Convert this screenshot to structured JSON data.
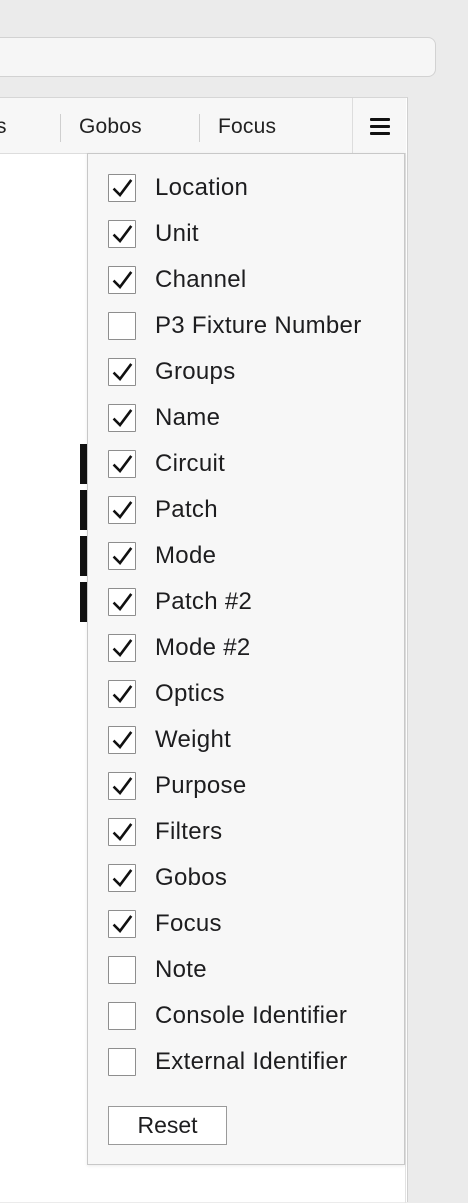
{
  "table": {
    "headers": [
      {
        "label": "s"
      },
      {
        "label": "Gobos"
      },
      {
        "label": "Focus"
      }
    ],
    "menu_icon": "hamburger-menu-icon"
  },
  "columns_menu": {
    "options": [
      {
        "label": "Location",
        "checked": true
      },
      {
        "label": "Unit",
        "checked": true
      },
      {
        "label": "Channel",
        "checked": true
      },
      {
        "label": "P3 Fixture Number",
        "checked": false
      },
      {
        "label": "Groups",
        "checked": true
      },
      {
        "label": "Name",
        "checked": true
      },
      {
        "label": "Circuit",
        "checked": true
      },
      {
        "label": "Patch",
        "checked": true
      },
      {
        "label": "Mode",
        "checked": true
      },
      {
        "label": "Patch #2",
        "checked": true
      },
      {
        "label": "Mode #2",
        "checked": true
      },
      {
        "label": "Optics",
        "checked": true
      },
      {
        "label": "Weight",
        "checked": true
      },
      {
        "label": "Purpose",
        "checked": true
      },
      {
        "label": "Filters",
        "checked": true
      },
      {
        "label": "Gobos",
        "checked": true
      },
      {
        "label": "Focus",
        "checked": true
      },
      {
        "label": "Note",
        "checked": false
      },
      {
        "label": "Console Identifier",
        "checked": false
      },
      {
        "label": "External Identifier",
        "checked": false
      }
    ],
    "reset_label": "Reset",
    "check_icon": "checkmark-icon"
  }
}
